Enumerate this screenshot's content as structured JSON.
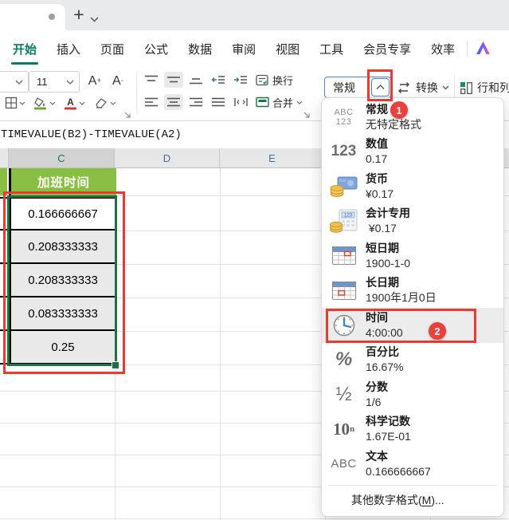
{
  "tabbar": {
    "new_tab_label": "+"
  },
  "ribbon": {
    "tabs": [
      "开始",
      "插入",
      "页面",
      "公式",
      "数据",
      "审阅",
      "视图",
      "工具",
      "会员专享",
      "效率"
    ]
  },
  "toolbar": {
    "font_size": "11",
    "font_grow": "A",
    "font_grow_sign": "+",
    "font_shrink": "A",
    "font_shrink_sign": "-",
    "wrap_label": "换行",
    "merge_label": "合并",
    "number_format_value": "常规",
    "convert_label": "转换",
    "rowcol_label": "行和列"
  },
  "formula_bar": {
    "formula": "TIMEVALUE(B2)-TIMEVALUE(A2)"
  },
  "sheet": {
    "columns": [
      "C",
      "D",
      "E"
    ],
    "header_cell": "加班时间",
    "values": [
      "0.166666667",
      "0.208333333",
      "0.208333333",
      "0.083333333",
      "0.25"
    ]
  },
  "menu": {
    "items": [
      {
        "label": "常规",
        "example": "无特定格式"
      },
      {
        "label": "数值",
        "example": "0.17"
      },
      {
        "label": "货币",
        "example": "¥0.17"
      },
      {
        "label": "会计专用",
        "example": " ¥0.17"
      },
      {
        "label": "短日期",
        "example": "1900-1-0"
      },
      {
        "label": "长日期",
        "example": "1900年1月0日"
      },
      {
        "label": "时间",
        "example": "4:00:00"
      },
      {
        "label": "百分比",
        "example": "16.67%"
      },
      {
        "label": "分数",
        "example": "1/6"
      },
      {
        "label": "科学记数",
        "example": "1.67E-01"
      },
      {
        "label": "文本",
        "example": "0.166666667"
      }
    ],
    "icon_texts": {
      "abc_top": "ABC",
      "abc_bottom": "123",
      "num": "123",
      "percent": "%",
      "fraction": "½",
      "sci_base": "10",
      "sci_sup": "n",
      "text_abc": "ABC"
    },
    "footer": {
      "pre": "其他数字格式(",
      "key": "M",
      "post": ")..."
    }
  },
  "annotations": {
    "step1": "1",
    "step2": "2"
  },
  "colors": {
    "header_green": "#88be42",
    "selection_green": "#1f7143",
    "annotation_red": "#ea3b33",
    "active_tab_teal": "#0a7c66",
    "combo_blue": "#4e7fd0"
  }
}
